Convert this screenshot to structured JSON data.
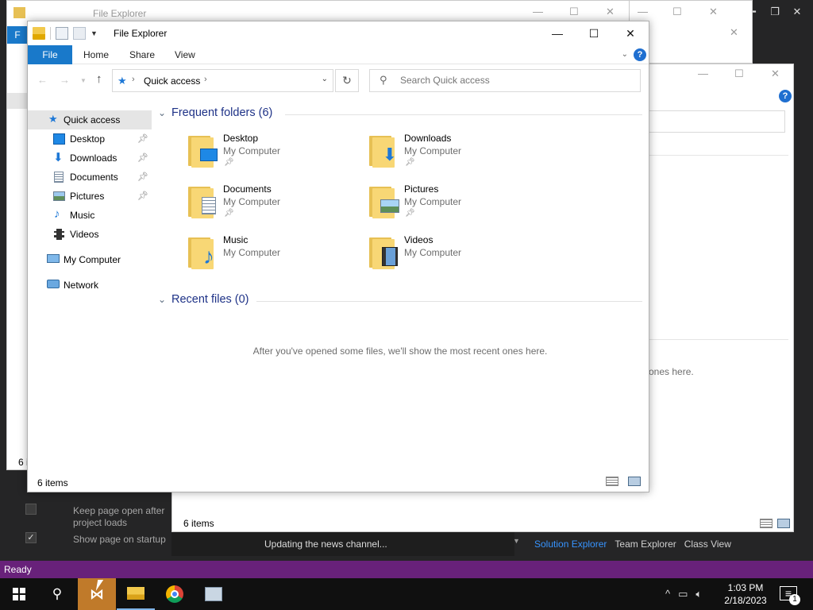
{
  "vs": {
    "status": "Ready",
    "news": "Updating the news channel...",
    "option_keep_open": "Keep page open after project loads",
    "option_show_startup": "Show page on startup",
    "tabs": [
      "Solution Explorer",
      "Team Explorer",
      "Class View"
    ],
    "active_tab": "Solution Explorer",
    "status_color": "#68217a"
  },
  "back_windows": {
    "title": "File Explorer",
    "items_count": "6 items",
    "recent_empty_partial": "ones here.",
    "file_tab_partial": "F",
    "items_partial": "6 i"
  },
  "explorer": {
    "title": "File Explorer",
    "ribbon_tabs": [
      "File",
      "Home",
      "Share",
      "View"
    ],
    "address": "Quick access",
    "search_placeholder": "Search Quick access",
    "nav": [
      {
        "label": "Quick access",
        "icon": "star-icon"
      },
      {
        "label": "Desktop",
        "icon": "desktop-icon",
        "pinned": true
      },
      {
        "label": "Downloads",
        "icon": "downloads-icon",
        "pinned": true
      },
      {
        "label": "Documents",
        "icon": "documents-icon",
        "pinned": true
      },
      {
        "label": "Pictures",
        "icon": "pictures-icon",
        "pinned": true
      },
      {
        "label": "Music",
        "icon": "music-icon"
      },
      {
        "label": "Videos",
        "icon": "videos-icon"
      },
      {
        "label": "My Computer",
        "icon": "computer-icon"
      },
      {
        "label": "Network",
        "icon": "network-icon"
      }
    ],
    "frequent_title": "Frequent folders (6)",
    "recent_title": "Recent files (0)",
    "recent_empty": "After you've opened some files, we'll show the most recent ones here.",
    "folders": [
      {
        "name": "Desktop",
        "location": "My Computer",
        "pinned": true,
        "badge": "desktop-icon"
      },
      {
        "name": "Downloads",
        "location": "My Computer",
        "pinned": true,
        "badge": "download-arrow-icon"
      },
      {
        "name": "Documents",
        "location": "My Computer",
        "pinned": true,
        "badge": "document-icon"
      },
      {
        "name": "Pictures",
        "location": "My Computer",
        "pinned": true,
        "badge": "picture-icon"
      },
      {
        "name": "Music",
        "location": "My Computer",
        "pinned": false,
        "badge": "music-note-icon"
      },
      {
        "name": "Videos",
        "location": "My Computer",
        "pinned": false,
        "badge": "film-icon"
      }
    ],
    "items_count": "6 items",
    "accent": "#1979ca"
  },
  "taskbar": {
    "time": "1:03 PM",
    "date": "2/18/2023",
    "notification_count": "1"
  }
}
